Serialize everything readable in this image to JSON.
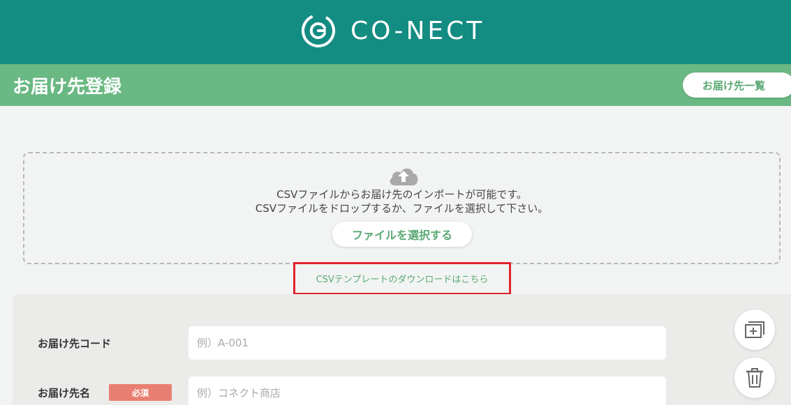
{
  "header": {
    "logo_text": "CO-NECT",
    "logo_icon": "conect-logo-icon",
    "background": "#138c82"
  },
  "titlebar": {
    "title": "お届け先登録",
    "list_button_label": "お届け先一覧",
    "background": "#6ab883"
  },
  "dropzone": {
    "icon": "cloud-upload-icon",
    "line1": "CSVファイルからお届け先のインポートが可能です。",
    "line2": "CSVファイルをドロップするか、ファイルを選択して下さい。",
    "select_button_label": "ファイルを選択する"
  },
  "csv_template_link": "CSVテンプレートのダウンロードはこちら",
  "form": {
    "fields": [
      {
        "label": "お届け先コード",
        "placeholder": "例）A-001",
        "required": false
      },
      {
        "label": "お届け先名",
        "placeholder": "例）コネクト商店",
        "required": true,
        "required_label": "必須"
      }
    ]
  },
  "actions": {
    "add_icon": "add-copy-icon",
    "delete_icon": "trash-icon"
  },
  "colors": {
    "accent_green": "#5aa874",
    "required_red": "#e87f72",
    "highlight_red": "#e0242c"
  }
}
